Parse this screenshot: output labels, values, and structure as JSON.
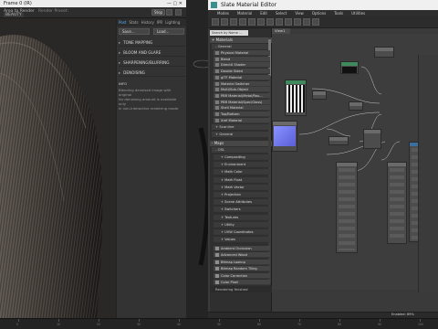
{
  "render_window": {
    "title": "Frame 0 (IR)",
    "toolbar": {
      "area_label": "Area to Render",
      "area_value": "",
      "viewport_label": "Viewport:",
      "preset_label": "Render Preset:",
      "view_dropdown": "BEAUTY",
      "stop_label": "Stop"
    },
    "tabs": [
      "Post",
      "Stats",
      "History",
      "IPR",
      "Lighting"
    ],
    "buttons": [
      "Save...",
      "Load..."
    ],
    "sections": [
      "TONE MAPPING",
      "BLOOM AND GLARE",
      "SHARPENING/BLURRING",
      "DENOISING"
    ],
    "info_heading": "INFO",
    "info_text": "Blending denoised image with original\nfor denoising amount is available only\nin non-interactive rendering mode."
  },
  "slate": {
    "title": "Slate Material Editor",
    "menu": [
      "Modes",
      "Material",
      "Edit",
      "Select",
      "View",
      "Options",
      "Tools",
      "Utilities"
    ],
    "search_placeholder": "Search by Name ...",
    "view_tab": "View1",
    "categories": {
      "materials": "+ Materials",
      "general": "- General",
      "scanline": "+ Scanline",
      "general2": "+ General",
      "maps": "- Maps",
      "osl": "- OSL",
      "scene_materials": "+ Scene Materials",
      "sample_slots": "+ Sample Slots"
    },
    "materials": [
      "Physical Material",
      "Blend",
      "DirectX Shader",
      "Double Sided",
      "glTF Material",
      "Material Switcher",
      "Multi/Sub-Object",
      "PBR Material(Metal/Rou...",
      "PBR Material(Spec/Gloss)",
      "Shell Material",
      "Top/Bottom",
      "Xref Material"
    ],
    "osl_groups": [
      "+ Compositing",
      "+ Environment",
      "+ Math Color",
      "+ Math Float",
      "+ Math Vector",
      "+ Projection",
      "+ Scene Attributes",
      "+ Switchers",
      "+ Textures",
      "+ Utility",
      "+ UVW Coordinates",
      "+ Values"
    ],
    "map_items": [
      "Ambient Occlusion",
      "Advanced Wood",
      "Bitmap Lookup",
      "Bitmap Random Tiling",
      "Color Correction",
      "Color Pixel"
    ],
    "status": "Rendering finished",
    "zoom_label": "Enabled: 89%"
  },
  "timeline": {
    "ticks": [
      "0",
      "10",
      "20",
      "30",
      "40",
      "50",
      "60",
      "70",
      "80",
      "90",
      "100"
    ]
  }
}
